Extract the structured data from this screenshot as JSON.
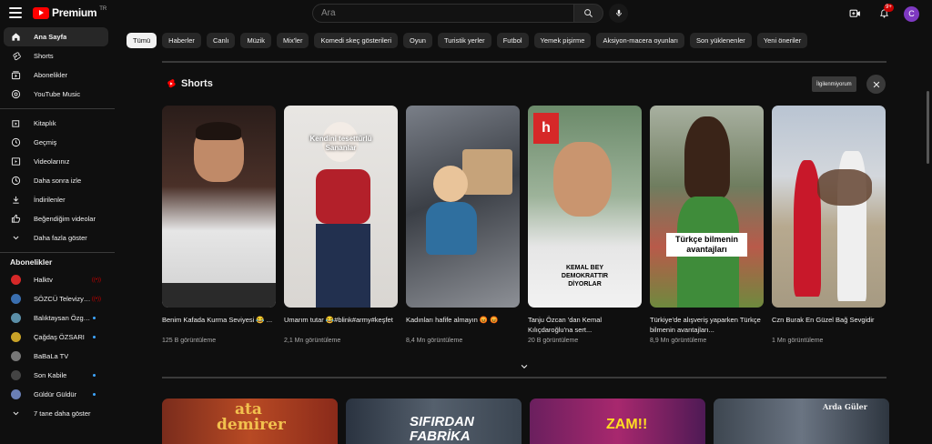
{
  "header": {
    "logo_text": "Premium",
    "logo_country": "TR",
    "search_placeholder": "Ara",
    "notification_count": "9+",
    "avatar_letter": "C",
    "colors": {
      "brand": "#ff0000",
      "avatar_bg": "#7e39c1",
      "badge": "#cc0000"
    }
  },
  "sidebar": {
    "main_items": [
      {
        "label": "Ana Sayfa",
        "icon": "home-icon"
      },
      {
        "label": "Shorts",
        "icon": "shorts-icon"
      },
      {
        "label": "Abonelikler",
        "icon": "subscriptions-icon"
      },
      {
        "label": "YouTube Music",
        "icon": "music-icon"
      }
    ],
    "library_items": [
      {
        "label": "Kitaplık",
        "icon": "library-icon"
      },
      {
        "label": "Geçmiş",
        "icon": "history-icon"
      },
      {
        "label": "Videolarınız",
        "icon": "your-videos-icon"
      },
      {
        "label": "Daha sonra izle",
        "icon": "watch-later-icon"
      },
      {
        "label": "İndirilenler",
        "icon": "download-icon"
      },
      {
        "label": "Beğendiğim videolar",
        "icon": "like-icon"
      },
      {
        "label": "Daha fazla göster",
        "icon": "chevron-down-icon"
      }
    ],
    "subscriptions_title": "Abonelikler",
    "subscriptions": [
      {
        "label": "Halktv",
        "color": "#d62828",
        "status": "live"
      },
      {
        "label": "SÖZCÜ Televizyo...",
        "color": "#3a6fb0",
        "status": "live"
      },
      {
        "label": "Balıktaysan Özgürs...",
        "color": "#5b8fa8",
        "status": "new"
      },
      {
        "label": "Çağdaş ÖZSARI",
        "color": "#c9a227",
        "status": "new"
      },
      {
        "label": "BaBaLa TV",
        "color": "#777777",
        "status": ""
      },
      {
        "label": "Son Kabile",
        "color": "#444444",
        "status": "new"
      },
      {
        "label": "Güldür Güldür",
        "color": "#6a7fb5",
        "status": "new"
      }
    ],
    "more_subscriptions": "7 tane daha göster"
  },
  "chips": [
    "Tümü",
    "Haberler",
    "Canlı",
    "Müzik",
    "Mix'ler",
    "Komedi skeç gösterileri",
    "Oyun",
    "Turistik yerler",
    "Futbol",
    "Yemek pişirme",
    "Aksiyon-macera oyunları",
    "Son yüklenenler",
    "Yeni öneriler"
  ],
  "shorts": {
    "title": "Shorts",
    "not_interested": "İlgilenmiyorum",
    "items": [
      {
        "title": "Benim Kafada Kurma Seviyesi 😂 ...",
        "views": "125 B görüntüleme",
        "caption": ""
      },
      {
        "title": "Umarım tutar 😂#blink#army#keşfet",
        "views": "2,1 Mn görüntüleme",
        "caption": "Kendini tesettürlü Sananlar"
      },
      {
        "title": "Kadınları hafife almayın 😡 😡",
        "views": "8,4 Mn görüntüleme",
        "caption": ""
      },
      {
        "title": "Tanju Özcan 'dan Kemal Kılıçdaroğlu'na sert...",
        "views": "20 B görüntüleme",
        "caption": "KEMAL BEY DEMOKRATTIR DİYORLAR"
      },
      {
        "title": "Türkiye'de alışveriş yaparken Türkçe bilmenin avantajları...",
        "views": "8,9 Mn görüntüleme",
        "caption": "Türkçe bilmenin avantajları"
      },
      {
        "title": "Czn Burak En Güzel Bağ Sevgidir",
        "views": "1 Mn görüntüleme",
        "caption": ""
      }
    ]
  },
  "videos": [
    {
      "thumb_text": "ata demirer"
    },
    {
      "thumb_text": "SIFIRDAN FABRİKA"
    },
    {
      "thumb_text": "ZAM!!"
    },
    {
      "thumb_text": "Arda Güler"
    }
  ]
}
